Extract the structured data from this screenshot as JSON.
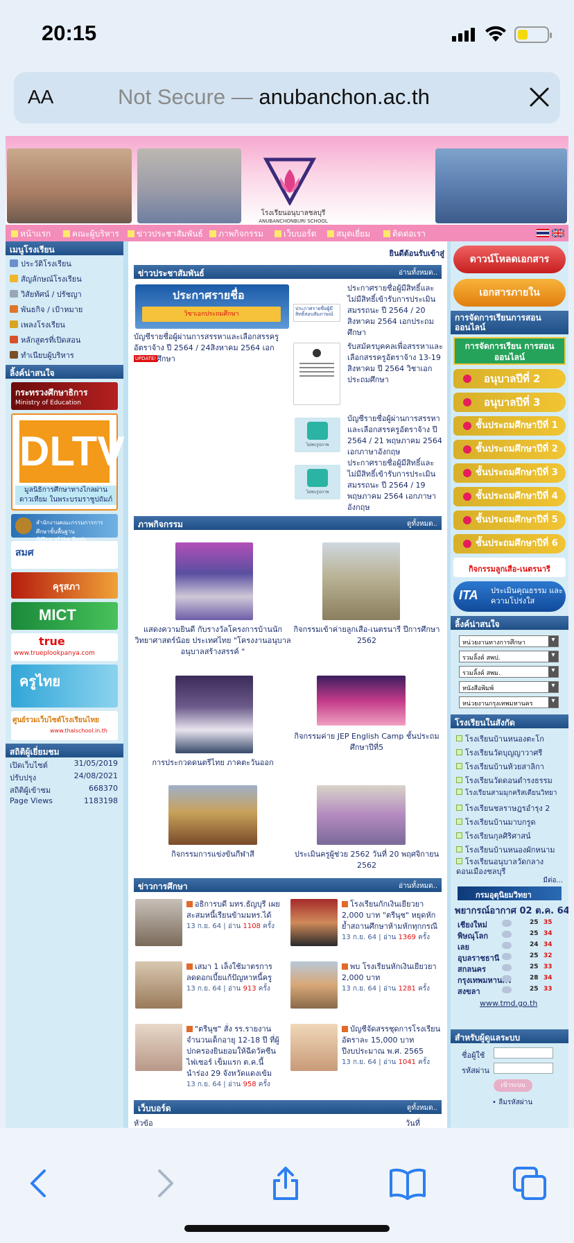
{
  "status": {
    "time": "20:15"
  },
  "browser": {
    "aa": "AA",
    "not_secure": "Not Secure —",
    "domain": "anubanchon.ac.th"
  },
  "banner": {
    "school_name": "โรงเรียนอนุบาลชลบุรี",
    "school_name_en": "ANUBANCHONBURI SCHOOL"
  },
  "topnav": [
    "หน้าแรก",
    "คณะผู้บริหาร",
    "ข่าวประชาสัมพันธ์",
    "ภาพกิจกรรม",
    "เว็บบอร์ด",
    "สมุดเยี่ยม",
    "ติดต่อเรา"
  ],
  "left": {
    "menu_title": "เมนูโรงเรียน",
    "menu": [
      "ประวัติโรงเรียน",
      "สัญลักษณ์โรงเรียน",
      "วิสัยทัศน์ / ปรัชญา",
      "พันธกิจ / เป้าหมาย",
      "เพลงโรงเรียน",
      "หลักสูตรที่เปิดสอน",
      "ทำเนียบผู้บริหาร"
    ],
    "links_title": "ลิ้งค์น่าสนใจ",
    "moe_label": "กระทรวงศึกษาธิการ",
    "moe_en": "Ministry of Education",
    "dltv_title": "DLTV",
    "dltv_caption": "มูลนิธิการศึกษาทางไกลผ่านดาวเทียม ในพระบรมราชูปถัมภ์",
    "obec": "สำนักงานคณะกรรมการการศึกษาขั้นพื้นฐาน",
    "obec_en": "Office of the Basic Education Commission",
    "smk": "สมศ",
    "kurusapa": "คุรุสภา",
    "mict": "MICT",
    "true": "true",
    "true_url": "www.trueplookpanya.com",
    "kruthai": "ครูไทย",
    "thaischool": "ศูนย์รวมเว็บไซต์โรงเรียนไทย",
    "thaischool_url": "www.thaischool.in.th",
    "stats_title": "สถิติผู้เยี่ยมชม",
    "stats": [
      {
        "label": "เปิดเว็บไซต์",
        "value": "31/05/2019"
      },
      {
        "label": "ปรับปรุง",
        "value": "24/08/2021"
      },
      {
        "label": "สถิติผู้เข้าชม",
        "value": "668370"
      },
      {
        "label": "Page Views",
        "value": "1183198"
      }
    ]
  },
  "main": {
    "welcome": "ยินดีต้อนรับเข้าสู่",
    "news_title": "ข่าวประชาสัมพันธ์",
    "read_all": "อ่านทั้งหมด..",
    "view_all": "ดูทั้งหมด..",
    "feature_banner": "ประกาศรายชื่อ",
    "feature_sub": "วิชาเอกประถมศึกษา",
    "feature_text": "บัญชีรายชื่อผู้ผ่านการสรรหาและเลือกสรรครูอัตราจ้าง ปี 2564 / 24สิงหาคม 2564 เอกประถมศึกษา",
    "update_badge": "UPDATE!",
    "thumb_label": "ไม่พบรูปภาพ",
    "thumb_text_1": "ประกาศรายชื่อผู้มีสิทธิ์สอบสัมภาษณ์",
    "news": [
      "ประกาศรายชื่อผู้มีสิทธิ์และไม่มีสิทธิ์เข้ารับการประเมินสมรรถนะ ปี 2564 / 20 สิงหาคม 2564 เอกประถมศึกษา",
      "รับสมัครบุคคลเพื่อสรรหาและเลือกสรรครูอัตราจ้าง 13-19 สิงหาคม ปี 2564 วิชาเอกประถมศึกษา",
      "บัญชีรายชื่อผู้ผ่านการสรรหาและเลือกสรรครูอัตราจ้าง ปี 2564 / 21 พฤษภาคม 2564 เอกภาษาอังกฤษ",
      "ประกาศรายชื่อผู้มีสิทธิ์และไม่มีสิทธิ์เข้ารับการประเมินสมรรถนะ ปี 2564 / 19 พฤษภาคม 2564 เอกภาษาอังกฤษ"
    ],
    "gallery_title": "ภาพกิจกรรม",
    "gallery": [
      "แสดงความยินดี กับรางวัลโครงการบ้านนักวิทยาศาสตร์น้อย ประเทศไทย \"โครงงานอนุบาลอนุบาลสร้างสรรค์ \"",
      "กิจกรรมเข้าค่ายลูกเสือ-เนตรนารี ปีการศึกษา 2562",
      "การประกวดดนตรีไทย ภาคตะวันออก",
      "กิจกรรมค่าย JEP English Camp ชั้นประถมศึกษาปีที่5",
      "กิจกรรมการแข่งขันกีฬาสี",
      "ประเมินครูผู้ช่วย 2562 วันที่ 20 พฤศจิกายน 2562"
    ],
    "edu_title": "ข่าวการศึกษา",
    "edu_news": [
      {
        "title": "อธิการบดี มทร.ธัญบุรี เผยสะสมหนี้เรียนข้ามมหร.ได้",
        "date": "13 ก.ย. 64",
        "reads": "1108"
      },
      {
        "title": "โรงเรียนกักเงินเยียวยา 2,000 บาท \"ตรีนุช\" หยุดหักย้ำสถานศึกษาห้ามหักทุกกรณี",
        "date": "13 ก.ย. 64",
        "reads": "1369"
      },
      {
        "title": "เสมา 1 เล็งใช้มาตรการลดดอกเบี้ยแก้ปัญหาหนี้ครู",
        "date": "13 ก.ย. 64",
        "reads": "913"
      },
      {
        "title": "พบ โรงเรียนหักเงินเยียวยา 2,000 บาท",
        "date": "13 ก.ย. 64",
        "reads": "1281"
      },
      {
        "title": "\"ตรีนุช\" สั่ง รร.รายงานจำนวนเด็กอายุ 12-18 ปี ที่ผู้ปกครองยินยอมให้ฉีดวัคซีนไฟเซอร์ เข็มแรก ต.ค.นี้ นำร่อง 29 จังหวัดแดงเข้ม",
        "date": "13 ก.ย. 64",
        "reads": "958"
      },
      {
        "title": "บัญชีจัดสรรชุดการโรงเรียน อัตราละ 15,000 บาท ปีงบประมาณ พ.ศ. 2565",
        "date": "13 ก.ย. 64",
        "reads": "1041"
      }
    ],
    "read_prefix": "| อ่าน",
    "read_suffix": "ครั้ง",
    "webboard_title": "เว็บบอร์ด",
    "webboard_col1": "หัวข้อ",
    "webboard_col2": "วันที่"
  },
  "right": {
    "download": "ดาวน์โหลดเอกสาร",
    "internal_docs": "เอกสารภายใน",
    "online_title": "การจัดการเรียนการสอนออนไลน์",
    "online_btn": "การจัดการเรียน การสอนออนไลน์",
    "grades": [
      "อนุบาลปีที่ 2",
      "อนุบาลปีที่ 3",
      "ชั้นประถมศึกษาปีที่ 1",
      "ชั้นประถมศึกษาปีที่ 2",
      "ชั้นประถมศึกษาปีที่ 3",
      "ชั้นประถมศึกษาปีที่ 4",
      "ชั้นประถมศึกษาปีที่ 5",
      "ชั้นประถมศึกษาปีที่ 6"
    ],
    "scout": "กิจกรรมลูกเสือ-เนตรนารี",
    "ita": "ITA",
    "ita_text": "ประเมินคุณธรรม และความโปร่งใส",
    "links_title": "ลิ้งค์น่าสนใจ",
    "selects": [
      "หน่วยงานทางการศึกษา",
      "รวมลิ้งค์ สพป.",
      "รวมลิ้งค์ สพม.",
      "หนังสือพิมพ์",
      "หน่วยงานกรุงเทพมหานคร"
    ],
    "network_title": "โรงเรียนในสังกัด",
    "schools": [
      "โรงเรียนบ้านหนองตะโก",
      "โรงเรียนวัดบุญญาวาศรี",
      "โรงเรียนบ้านห้วยสาลิกา",
      "โรงเรียนวัดดอนดำรงธรรม",
      "โรงเรียนสามมุกคริสเตียนวิทยา",
      "โรงเรียนชลราษฎรอำรุง 2",
      "โรงเรียนบ้านมาบกรูด",
      "โรงเรียนกุลศิริศาสน์",
      "โรงเรียนบ้านหนองผักหนาม",
      "โรงเรียนอนุบาลวัดกลาง ดอนเมืองชลบุรี"
    ],
    "more": "มีต่อ...",
    "tmd_logo": "กรมอุตุนิยมวิทยา",
    "forecast": "พยากรณ์อากาศ 02 ต.ค. 64",
    "weather": [
      {
        "city": "เชียงใหม่",
        "lo": "25",
        "hi": "35"
      },
      {
        "city": "พิษณุโลก",
        "lo": "25",
        "hi": "34"
      },
      {
        "city": "เลย",
        "lo": "24",
        "hi": "34"
      },
      {
        "city": "อุบลราชธานี",
        "lo": "25",
        "hi": "32"
      },
      {
        "city": "สกลนคร",
        "lo": "25",
        "hi": "33"
      },
      {
        "city": "กรุงเทพมหานคร",
        "lo": "28",
        "hi": "34"
      },
      {
        "city": "สงขลา",
        "lo": "25",
        "hi": "33"
      }
    ],
    "tmd_url": "www.tmd.go.th",
    "login_title": "สำหรับผู้ดูแลระบบ",
    "user_label": "ชื่อผู้ใช้",
    "pass_label": "รหัสผ่าน",
    "login_btn": "เข้าระบบ",
    "forgot": "• ลืมรหัสผ่าน"
  },
  "colors": {
    "accent_pink": "#f38cb9",
    "header_blue": "#2a5a94",
    "grade_gold": "#e3b82e",
    "download_red": "#e63b3b"
  }
}
